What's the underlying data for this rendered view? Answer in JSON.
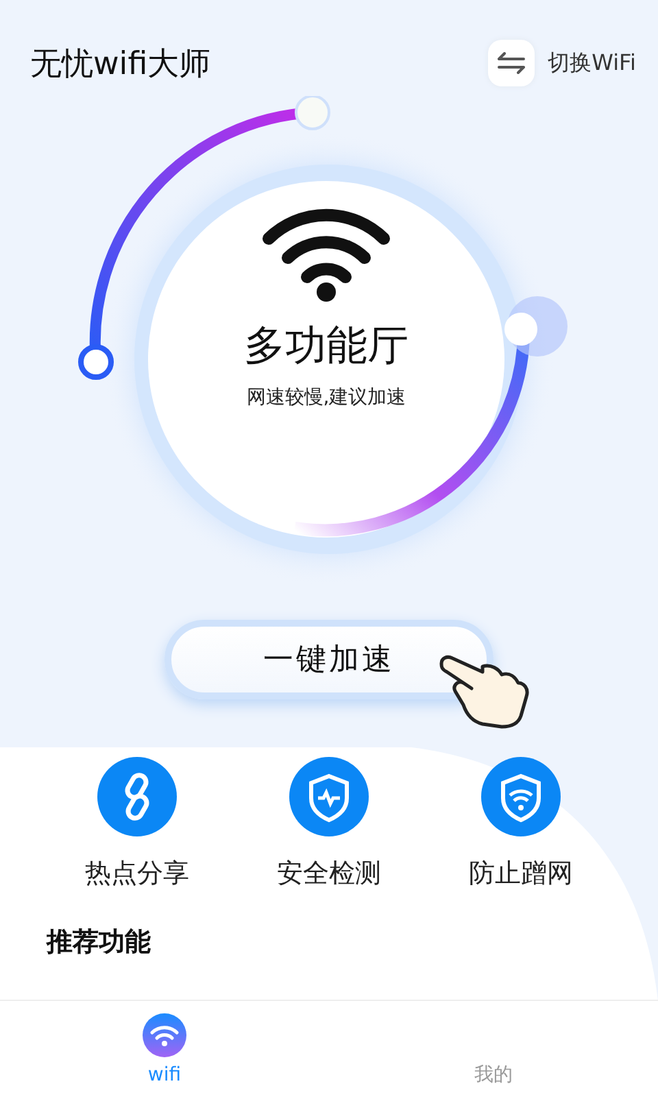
{
  "app_title": "无忧wifi大师",
  "switch_button": {
    "label": "切换WiFi"
  },
  "status": {
    "title": "多功能厅",
    "subtitle": "网速较慢,建议加速"
  },
  "boost_button": {
    "label": "一键加速"
  },
  "features": [
    {
      "label": "热点分享",
      "kind": "link"
    },
    {
      "label": "安全检测",
      "kind": "shield-pulse"
    },
    {
      "label": "防止蹭网",
      "kind": "shield-wifi"
    }
  ],
  "section_title": "推荐功能",
  "tabs": [
    {
      "label": "wifi",
      "selected": true
    },
    {
      "label": "我的",
      "selected": false
    }
  ]
}
